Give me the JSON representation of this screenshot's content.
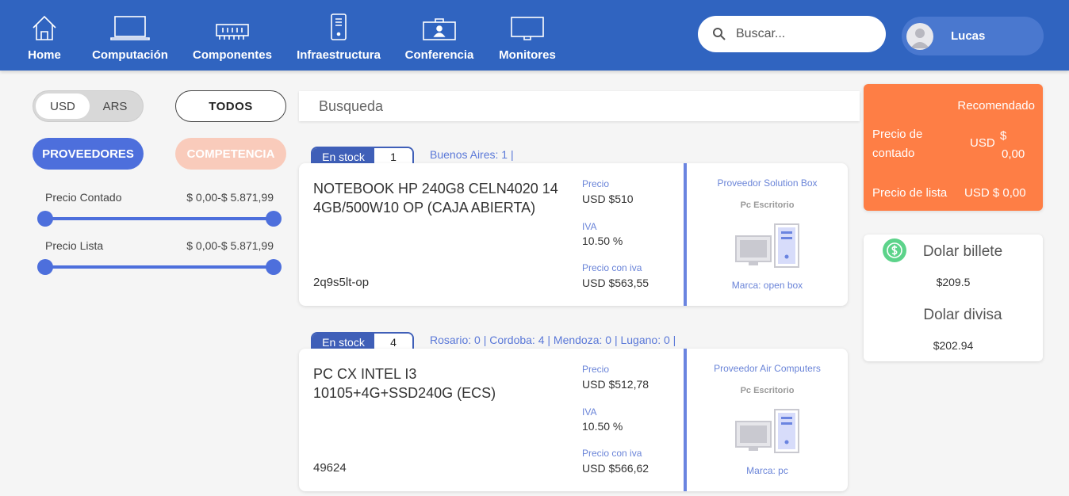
{
  "nav": {
    "items": [
      {
        "label": "Home",
        "icon": "home-icon"
      },
      {
        "label": "Computación",
        "icon": "laptop-icon"
      },
      {
        "label": "Componentes",
        "icon": "memory-icon"
      },
      {
        "label": "Infraestructura",
        "icon": "server-icon"
      },
      {
        "label": "Conferencia",
        "icon": "projector-icon"
      },
      {
        "label": "Monitores",
        "icon": "monitor-icon"
      }
    ],
    "search_placeholder": "Buscar...",
    "user_name": "Lucas"
  },
  "filters": {
    "currency_options": [
      "USD",
      "ARS"
    ],
    "currency_selected": "USD",
    "todos_label": "TODOS",
    "proveedores_label": "PROVEEDORES",
    "competencia_label": "COMPETENCIA",
    "precio_contado": {
      "label": "Precio Contado",
      "range_text": "$ 0,00-$ 5.871,99",
      "min": 0,
      "max": 5871.99
    },
    "precio_lista": {
      "label": "Precio Lista",
      "range_text": "$ 0,00-$ 5.871,99",
      "min": 0,
      "max": 5871.99
    }
  },
  "search_header": "Busqueda",
  "products": [
    {
      "stock_label": "En stock",
      "stock_count": "1",
      "locations": "Buenos Aires: 1 |",
      "name": "NOTEBOOK HP 240G8 CELN4020 14 4GB/500W10 OP (CAJA ABIERTA)",
      "code": "2q9s5lt-op",
      "precio_label": "Precio",
      "precio": "USD $510",
      "iva_label": "IVA",
      "iva": "10.50 %",
      "precio_iva_label": "Precio con iva",
      "precio_iva": "USD $563,55",
      "proveedor": "Proveedor Solution Box",
      "categoria": "Pc Escritorio",
      "marca": "Marca: open box"
    },
    {
      "stock_label": "En stock",
      "stock_count": "4",
      "locations": "Rosario: 0 |  Cordoba: 4 |  Mendoza: 0 |  Lugano: 0 |",
      "name": "PC CX INTEL I3 10105+4G+SSD240G (ECS)",
      "code": "49624",
      "precio_label": "Precio",
      "precio": "USD $512,78",
      "iva_label": "IVA",
      "iva": "10.50 %",
      "precio_iva_label": "Precio con iva",
      "precio_iva": "USD $566,62",
      "proveedor": "Proveedor Air Computers",
      "categoria": "Pc Escritorio",
      "marca": "Marca: pc"
    }
  ],
  "recomendado": {
    "title": "Recomendado",
    "contado_label": "Precio de contado",
    "contado_currency": "USD",
    "contado_symbol": "$",
    "contado_value": "0,00",
    "lista_label": "Precio de lista",
    "lista_value": "USD  $ 0,00"
  },
  "dolar": {
    "billete_label": "Dolar billete",
    "billete_value": "$209.5",
    "divisa_label": "Dolar divisa",
    "divisa_value": "$202.94"
  },
  "colors": {
    "navbar": "#3064c0",
    "accent": "#4d6fdc",
    "reco": "#fe7e45",
    "competencia": "#f9cbbb",
    "coin": "#5cd38a"
  }
}
